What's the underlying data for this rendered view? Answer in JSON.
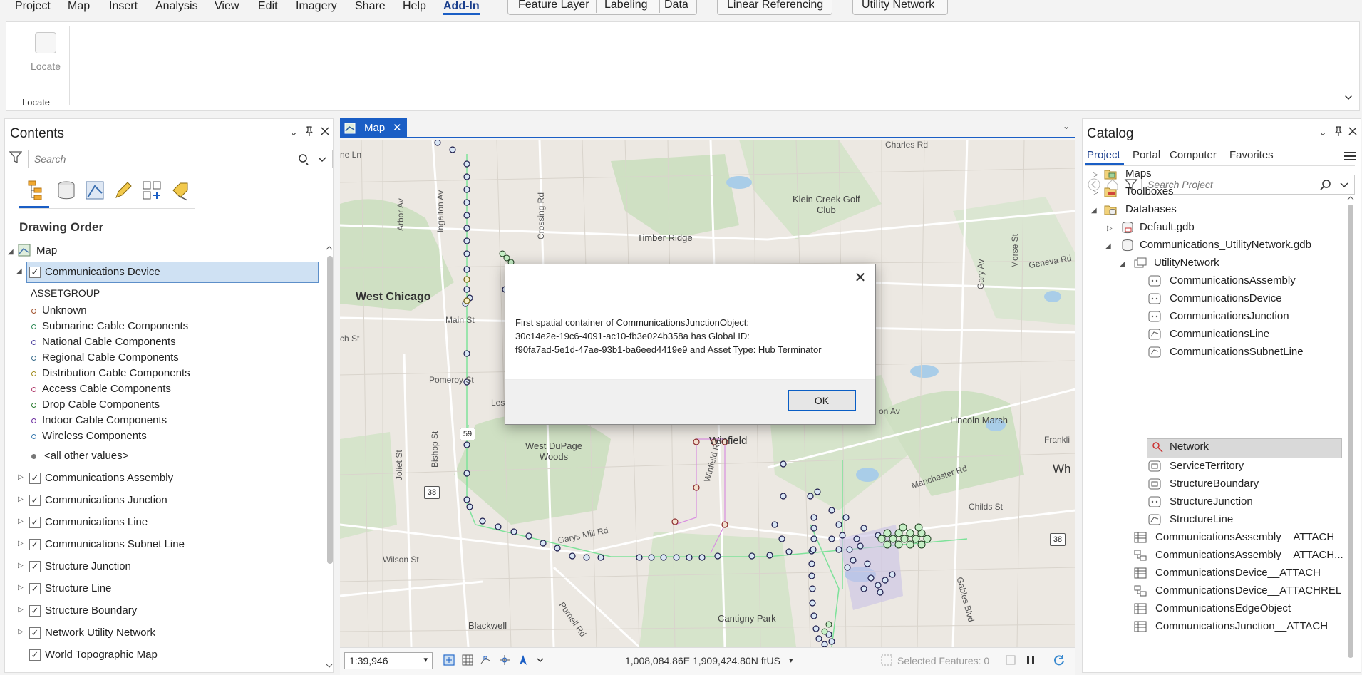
{
  "menu": {
    "tabs": [
      "Project",
      "Map",
      "Insert",
      "Analysis",
      "View",
      "Edit",
      "Imagery",
      "Share",
      "Help",
      "Add-In"
    ],
    "active": "Add-In",
    "context_tabs": [
      "Feature Layer",
      "Labeling",
      "Data"
    ],
    "linear_ref": "Linear Referencing",
    "utility_network": "Utility Network"
  },
  "ribbon": {
    "locate_label": "Locate",
    "group_label": "Locate"
  },
  "contents": {
    "title": "Contents",
    "search_placeholder": "Search",
    "drawing_order": "Drawing Order",
    "map_label": "Map",
    "selected_layer": "Communications Device",
    "legend_header": "ASSETGROUP",
    "legend": [
      {
        "label": "Unknown",
        "color": "#a0522d"
      },
      {
        "label": "Submarine Cable Components",
        "color": "#2e8b57"
      },
      {
        "label": "National Cable Components",
        "color": "#4b3f9e"
      },
      {
        "label": "Regional Cable Components",
        "color": "#3a6d8c"
      },
      {
        "label": "Distribution Cable Components",
        "color": "#a08a1a"
      },
      {
        "label": "Access Cable Components",
        "color": "#b03a6a"
      },
      {
        "label": "Drop Cable Components",
        "color": "#2e7d32"
      },
      {
        "label": "Indoor Cable Components",
        "color": "#6a2a9e"
      },
      {
        "label": "Wireless Components",
        "color": "#3a7ab0"
      }
    ],
    "other_values": "<all other values>",
    "layers": [
      "Communications Assembly",
      "Communications Junction",
      "Communications Line",
      "Communications Subnet Line",
      "Structure Junction",
      "Structure Line",
      "Structure Boundary",
      "Network Utility Network",
      "World Topographic Map"
    ]
  },
  "map": {
    "tab_label": "Map",
    "labels": {
      "west_chicago": "West Chicago",
      "winfield": "Winfield",
      "west_dupage": "West DuPage\nWoods",
      "timber_ridge": "Timber Ridge",
      "klein_creek": "Klein Creek Golf\nClub",
      "lincoln_marsh": "Lincoln Marsh",
      "cantigny": "Cantigny Park",
      "blackwell": "Blackwell",
      "main_st": "Main St",
      "pomeroy": "Pomeroy St",
      "wilson_st": "Wilson St",
      "garys_mill": "Garys Mill Rd",
      "manchester": "Manchester Rd",
      "childs_st": "Childs St",
      "geneva_rd": "Geneva Rd",
      "arbor_av": "Arbor Av",
      "ingalton_av": "Ingalton Av",
      "crossing_rd": "Crossing Rd",
      "joliet_st": "Joliet St",
      "bishop_st": "Bishop St",
      "gary_av": "Gary Av",
      "morse_st": "Morse St",
      "gables_blvd": "Gables Blvd",
      "purnell_rd": "Purnell Rd",
      "winfield_rd": "Winfield Rd",
      "charles_rd": "Charles Rd",
      "lane": "ne Ln",
      "les": "Les",
      "on_av": "on Av",
      "frankli": "Frankli",
      "wh": "Wh",
      "ch_st": "ch St",
      "shield_59": "59",
      "shield_38a": "38",
      "shield_38b": "38"
    }
  },
  "status": {
    "scale": "1:39,946",
    "coords": "1,008,084.86E 1,909,424.80N ftUS",
    "selected_features": "Selected Features: 0"
  },
  "dialog": {
    "message_line1": "First spatial container of CommunicationsJunctionObject:",
    "message_line2": "30c14e2e-19c6-4091-ac10-fb3e024b358a has Global ID:",
    "message_line3": "f90fa7ad-5e1d-47ae-93b1-ba6eed4419e9 and Asset Type: Hub Terminator",
    "ok_label": "OK"
  },
  "catalog": {
    "title": "Catalog",
    "tabs": [
      "Project",
      "Portal",
      "Computer",
      "Favorites"
    ],
    "search_placeholder": "Search Project",
    "items": [
      {
        "label": "Maps",
        "icon": "folder-maps-icon"
      },
      {
        "label": "Toolboxes",
        "icon": "folder-toolbox-icon"
      },
      {
        "label": "Databases",
        "icon": "folder-database-icon"
      },
      {
        "label": "Default.gdb",
        "icon": "gdb-icon"
      },
      {
        "label": "Communications_UtilityNetwork.gdb",
        "icon": "gdb-icon"
      },
      {
        "label": "UtilityNetwork",
        "icon": "feature-dataset-icon"
      },
      {
        "label": "CommunicationsAssembly",
        "icon": "point-fc-icon"
      },
      {
        "label": "CommunicationsDevice",
        "icon": "point-fc-icon"
      },
      {
        "label": "CommunicationsJunction",
        "icon": "point-fc-icon"
      },
      {
        "label": "CommunicationsLine",
        "icon": "line-fc-icon"
      },
      {
        "label": "CommunicationsSubnetLine",
        "icon": "line-fc-icon"
      },
      {
        "label": "Network",
        "icon": "network-icon"
      },
      {
        "label": "ServiceTerritory",
        "icon": "polygon-fc-icon"
      },
      {
        "label": "StructureBoundary",
        "icon": "polygon-fc-icon"
      },
      {
        "label": "StructureJunction",
        "icon": "point-fc-icon"
      },
      {
        "label": "StructureLine",
        "icon": "line-fc-icon"
      },
      {
        "label": "CommunicationsAssembly__ATTACH",
        "icon": "table-icon"
      },
      {
        "label": "CommunicationsAssembly__ATTACH...",
        "icon": "relationship-icon"
      },
      {
        "label": "CommunicationsDevice__ATTACH",
        "icon": "table-icon"
      },
      {
        "label": "CommunicationsDevice__ATTACHREL",
        "icon": "relationship-icon"
      },
      {
        "label": "CommunicationsEdgeObject",
        "icon": "table-icon"
      },
      {
        "label": "CommunicationsJunction__ATTACH",
        "icon": "table-icon"
      }
    ]
  }
}
